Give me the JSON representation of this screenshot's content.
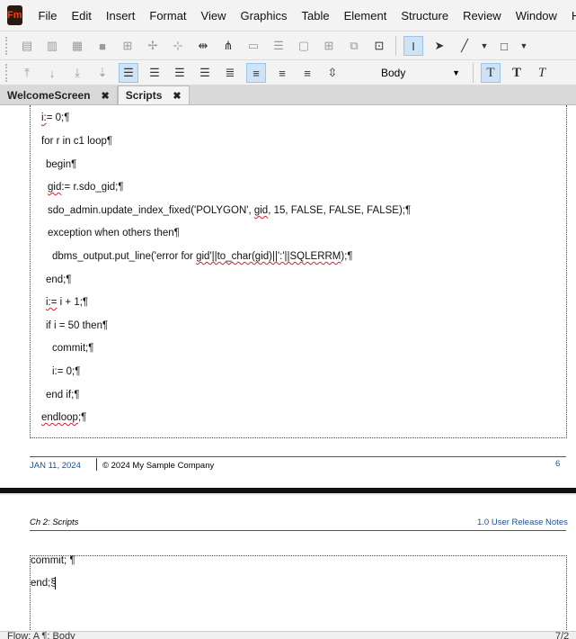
{
  "app": {
    "logo": "Fm"
  },
  "menu": [
    "File",
    "Edit",
    "Insert",
    "Format",
    "View",
    "Graphics",
    "Table",
    "Element",
    "Structure",
    "Review",
    "Window",
    "Help"
  ],
  "toolbar2": {
    "paragraph_format": "Body"
  },
  "tabs": [
    {
      "label": "WelcomeScreen",
      "active": false
    },
    {
      "label": "Scripts",
      "active": true
    }
  ],
  "page1": {
    "lines": [
      {
        "pre": "",
        "spell": "i:",
        "post": "= 0;¶"
      },
      {
        "pre": "for r in c1 loop¶",
        "spell": "",
        "post": ""
      },
      {
        "pre": "begin¶",
        "spell": "",
        "post": ""
      },
      {
        "pre": "",
        "spell": "gid",
        "post": ":= r.sdo_gid;¶"
      },
      {
        "pre": "sdo_admin.update_index_fixed('POLYGON', ",
        "spell": "gid",
        "post": ", 15, FALSE, FALSE, FALSE);¶"
      },
      {
        "pre": "exception when others then¶",
        "spell": "",
        "post": ""
      },
      {
        "pre": "dbms_output.put_line('error for ",
        "spell": "gid'||to_char(gid)||':'||SQLERRM",
        "post": ");¶"
      },
      {
        "pre": "end;¶",
        "spell": "",
        "post": ""
      },
      {
        "pre": "",
        "spell": "i:=",
        "post": " i + 1;¶"
      },
      {
        "pre": "if i = 50 then¶",
        "spell": "",
        "post": ""
      },
      {
        "pre": "commit;¶",
        "spell": "",
        "post": ""
      },
      {
        "pre": "i:= 0;¶",
        "spell": "",
        "post": ""
      },
      {
        "pre": "end if;¶",
        "spell": "",
        "post": ""
      },
      {
        "pre": "",
        "spell": "endloop",
        "post": ";¶"
      }
    ],
    "footer": {
      "date": "JAN 11, 2024",
      "copyright": "© 2024 My Sample Company",
      "page_number": "6"
    }
  },
  "page2": {
    "header": {
      "chapter": "Ch 2: Scripts",
      "release": "1.0 User Release Notes"
    },
    "lines": [
      "commit; ¶",
      "end;§"
    ]
  },
  "status": {
    "left": "Flow: A ¶: Body",
    "right": "7/2"
  },
  "colors": {
    "footer_blue": "#1f4e8c",
    "spellcheck_red": "#d9232d",
    "tab_active_bg": "#f3f3f3"
  }
}
